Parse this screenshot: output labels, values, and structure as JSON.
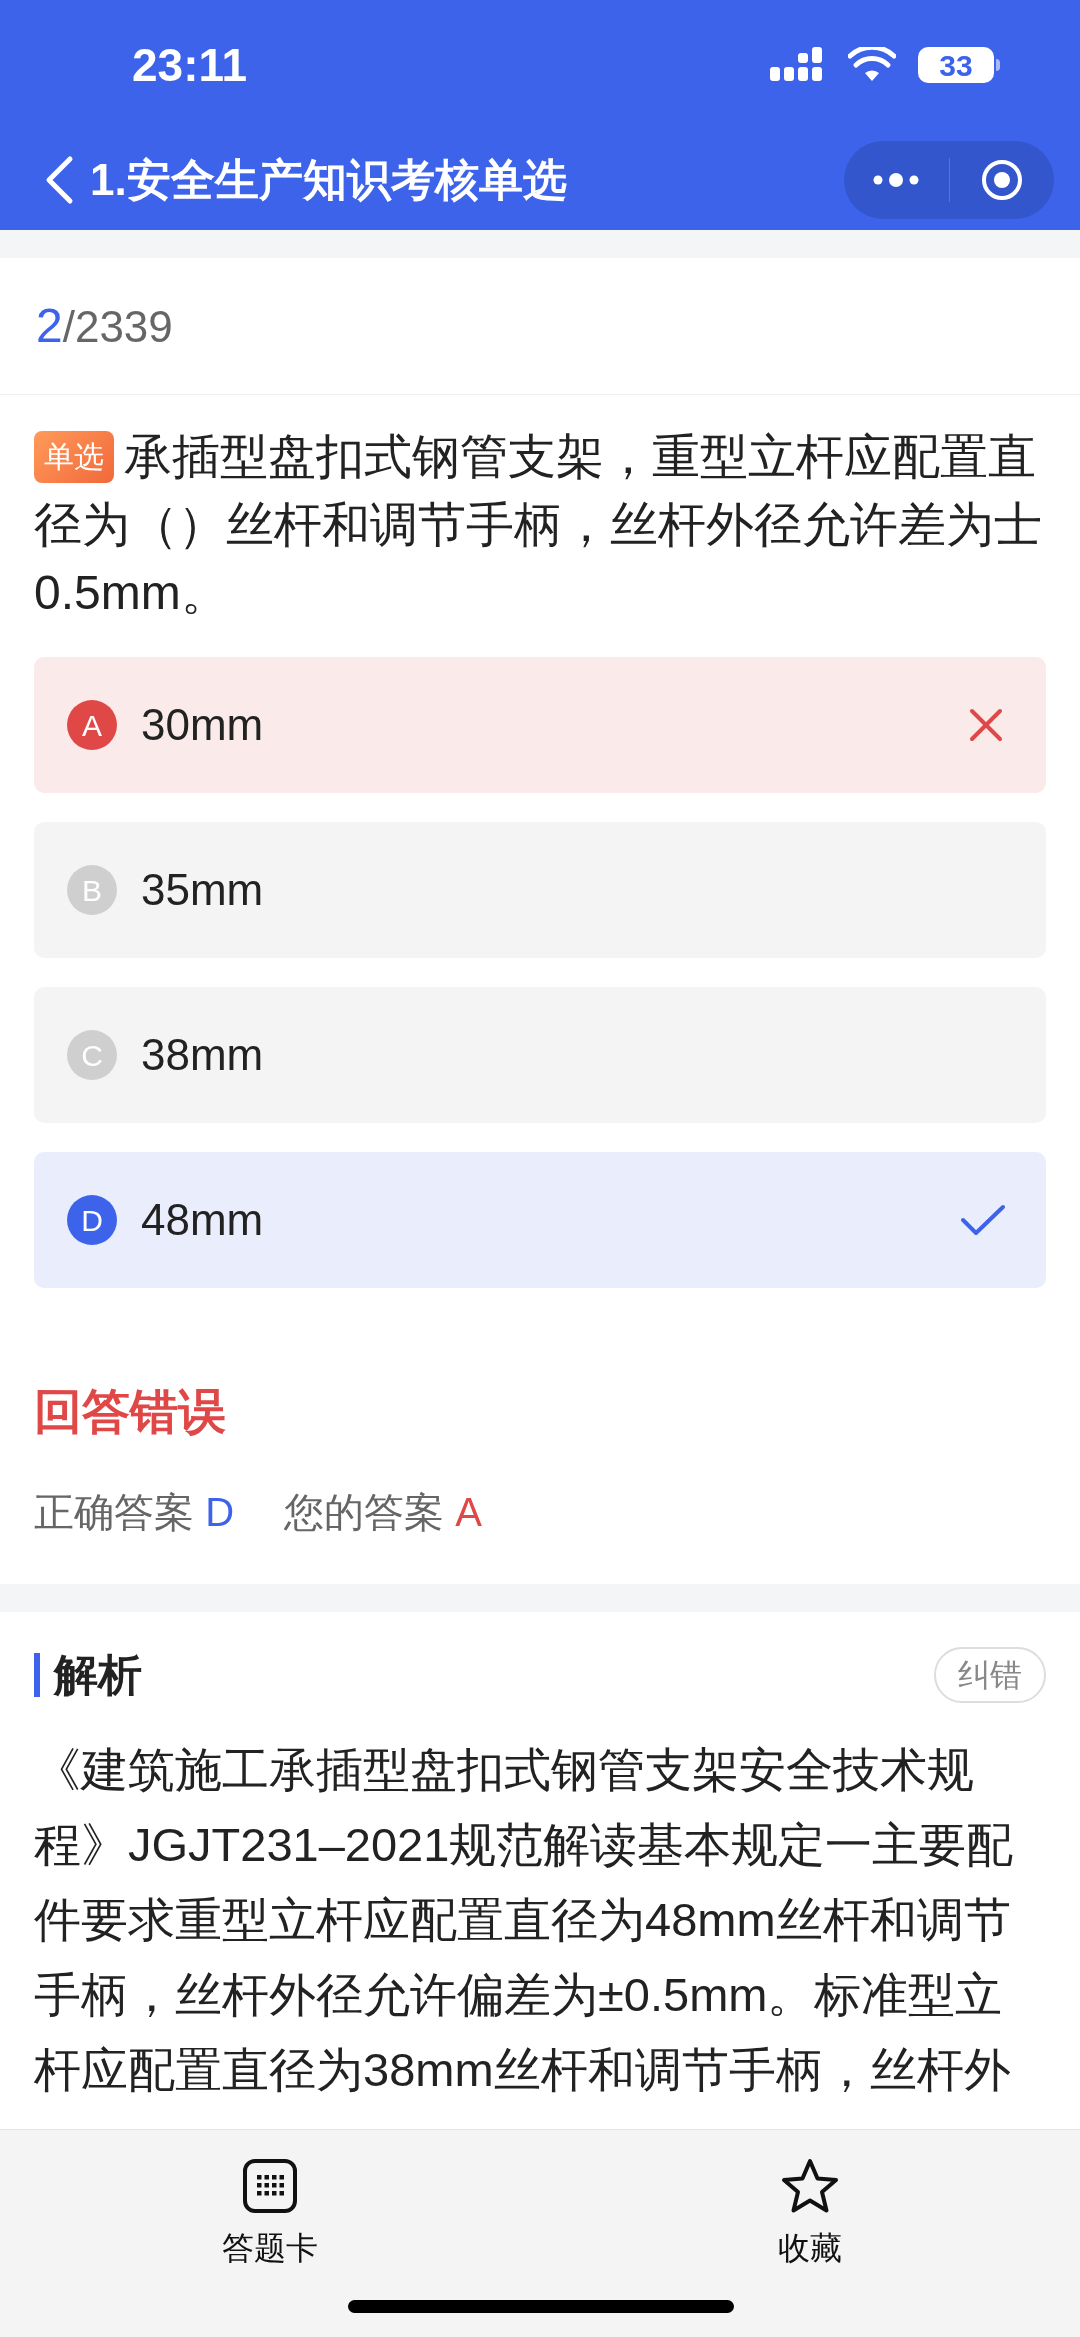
{
  "status_bar": {
    "time": "23:11",
    "battery": "33"
  },
  "nav": {
    "title": "1.安全生产知识考核单选"
  },
  "progress": {
    "current": "2",
    "total": "/2339"
  },
  "question": {
    "tag": "单选",
    "text": "承插型盘扣式钢管支架，重型立杆应配置直径为（）丝杆和调节手柄，丝杆外径允许差为士0.5mm。"
  },
  "options": [
    {
      "letter": "A",
      "text": "30mm",
      "selected": true,
      "correct": false
    },
    {
      "letter": "B",
      "text": "35mm",
      "selected": false,
      "correct": false
    },
    {
      "letter": "C",
      "text": "38mm",
      "selected": false,
      "correct": false
    },
    {
      "letter": "D",
      "text": "48mm",
      "selected": false,
      "correct": true
    }
  ],
  "verdict": {
    "title": "回答错误",
    "correct_label": "正确答案",
    "correct_value": "D",
    "yours_label": "您的答案",
    "yours_value": "A"
  },
  "analysis": {
    "title": "解析",
    "report_button": "纠错",
    "text": "《建筑施工承插型盘扣式钢管支架安全技术规程》JGJT231–2021规范解读基本规定一主要配件要求重型立杆应配置直径为48mm丝杆和调节手柄，丝杆外径允许偏差为±0.5mm。标准型立杆应配置直径为38mm丝杆和调节手柄，丝杆外"
  },
  "tab_bar": [
    {
      "label": "答题卡",
      "kind": "card"
    },
    {
      "label": "收藏",
      "kind": "star"
    }
  ]
}
